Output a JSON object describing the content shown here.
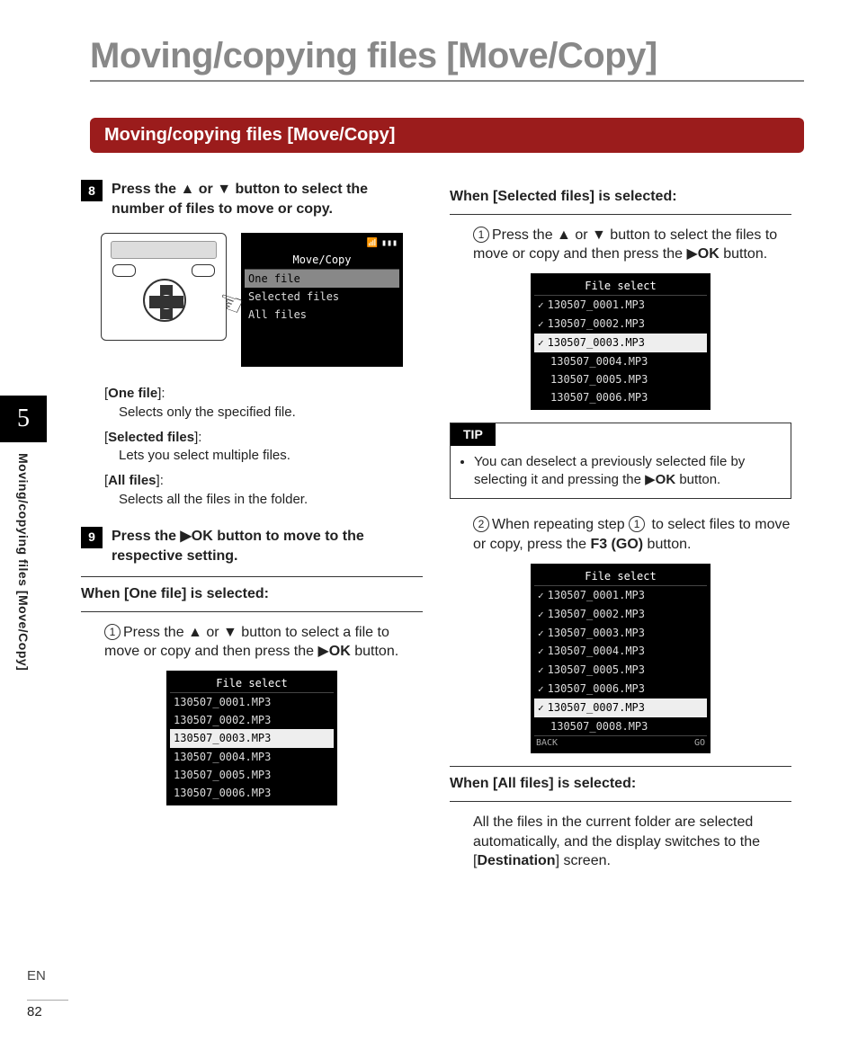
{
  "page_title": "Moving/copying files [Move/Copy]",
  "section_banner": "Moving/copying files [Move/Copy]",
  "chapter_number": "5",
  "side_label": "Moving/copying files [Move/Copy]",
  "lang": "EN",
  "page_number": "82",
  "steps": {
    "s8": {
      "num": "8",
      "pre": "Press the ",
      "sym1": "▲",
      "mid": " or ",
      "sym2": "▼",
      "post": " button to select the number of files to move or copy."
    },
    "s9": {
      "num": "9",
      "pre": "Press the ",
      "sym": "▶",
      "ok": "OK",
      "post": " button to move to the respective setting."
    }
  },
  "lcd_move": {
    "title": "Move/Copy",
    "items": [
      "One file",
      "Selected files",
      "All files"
    ],
    "selected_index": 0
  },
  "defs": [
    {
      "term_pre": "[",
      "term_bold": "One file",
      "term_post": "]:",
      "desc": "Selects only the specified file."
    },
    {
      "term_pre": "[",
      "term_bold": "Selected files",
      "term_post": "]:",
      "desc": "Lets you select multiple files."
    },
    {
      "term_pre": "[",
      "term_bold": "All files",
      "term_post": "]:",
      "desc": "Selects all the files in the folder."
    }
  ],
  "subheads": {
    "one": {
      "pre": "When [",
      "bold": "One file",
      "post": "] is selected:"
    },
    "selected": {
      "pre": "When [",
      "bold": "Selected files",
      "post": "] is selected:"
    },
    "all": {
      "pre": "When [",
      "bold": "All files",
      "post": "] is selected:"
    }
  },
  "substeps": {
    "one1": {
      "n": "1",
      "pre": "Press the ",
      "s1": "▲",
      "mid": " or ",
      "s2": "▼",
      "mid2": " button to select a file to move or copy and then press the ",
      "play": "▶",
      "ok": "OK",
      "post": " button."
    },
    "sel1": {
      "n": "1",
      "pre": "Press the ",
      "s1": "▲",
      "mid": " or ",
      "s2": "▼",
      "mid2": " button to select the files to move or copy and then press the ",
      "play": "▶",
      "ok": "OK",
      "post": " button."
    },
    "sel2": {
      "n": "2",
      "pre": "When repeating step ",
      "ref": "1",
      "mid": " to select files to move or copy, press the ",
      "bold": "F3 (GO)",
      "post": " button."
    }
  },
  "lcd_fs_title": "File select",
  "lcd_fs1": {
    "rows": [
      "130507_0001.MP3",
      "130507_0002.MP3",
      "130507_0003.MP3",
      "130507_0004.MP3",
      "130507_0005.MP3",
      "130507_0006.MP3"
    ],
    "selected_index": 2
  },
  "lcd_fs2": {
    "rows": [
      {
        "label": "130507_0001.MP3",
        "checked": true
      },
      {
        "label": "130507_0002.MP3",
        "checked": true
      },
      {
        "label": "130507_0003.MP3",
        "checked": true,
        "selected": true
      },
      {
        "label": "130507_0004.MP3",
        "checked": false
      },
      {
        "label": "130507_0005.MP3",
        "checked": false
      },
      {
        "label": "130507_0006.MP3",
        "checked": false
      }
    ]
  },
  "lcd_fs3": {
    "rows": [
      {
        "label": "130507_0001.MP3",
        "checked": true
      },
      {
        "label": "130507_0002.MP3",
        "checked": true
      },
      {
        "label": "130507_0003.MP3",
        "checked": true
      },
      {
        "label": "130507_0004.MP3",
        "checked": true
      },
      {
        "label": "130507_0005.MP3",
        "checked": true
      },
      {
        "label": "130507_0006.MP3",
        "checked": true
      },
      {
        "label": "130507_0007.MP3",
        "checked": true,
        "selected": true
      },
      {
        "label": "130507_0008.MP3",
        "checked": false
      }
    ],
    "foot_left": "BACK",
    "foot_right": "GO"
  },
  "tip": {
    "label": "TIP",
    "body_pre": "You can deselect a previously selected file by selecting it and pressing the ",
    "play": "▶",
    "ok": "OK",
    "body_post": " button."
  },
  "all_body": {
    "pre": "All the files in the current folder are selected automatically, and the display switches to the [",
    "bold": "Destination",
    "post": "] screen."
  },
  "dpad_center": "OK"
}
